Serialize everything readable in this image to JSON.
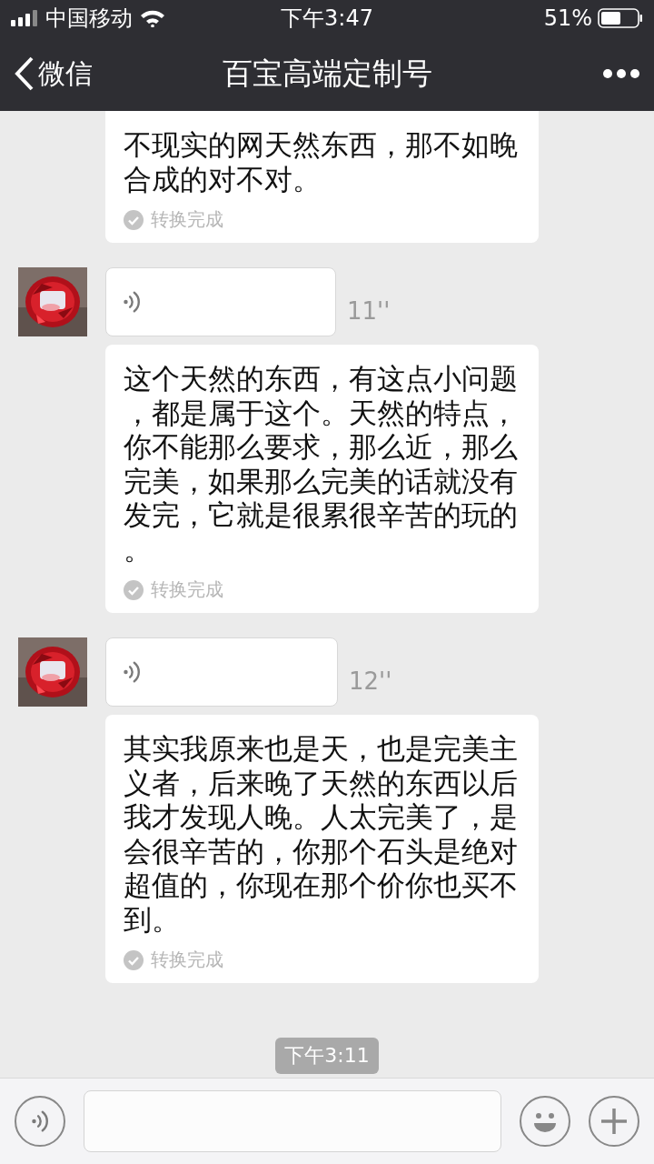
{
  "status_bar": {
    "carrier": "中国移动",
    "time": "下午3:47",
    "battery": "51%"
  },
  "nav": {
    "back": "微信",
    "title": "百宝高端定制号"
  },
  "messages": [
    {
      "kind": "transcript",
      "text": "不现实的网天然东西，那不如晚合成的对不对。",
      "status": "转换完成"
    },
    {
      "kind": "voice",
      "duration": "11''"
    },
    {
      "kind": "transcript",
      "text": "这个天然的东西，有这点小问题，都是属于这个。天然的特点，你不能那么要求，那么近，那么完美，如果那么完美的话就没有发完，它就是很累很辛苦的玩的。",
      "status": "转换完成"
    },
    {
      "kind": "voice",
      "duration": "12''"
    },
    {
      "kind": "transcript",
      "text": "其实我原来也是天，也是完美主义者，后来晚了天然的东西以后我才发现人晚。人太完美了，是会很辛苦的，你那个石头是绝对超值的，你现在那个价你也买不到。",
      "status": "转换完成"
    }
  ],
  "timestamp": "下午3:11"
}
